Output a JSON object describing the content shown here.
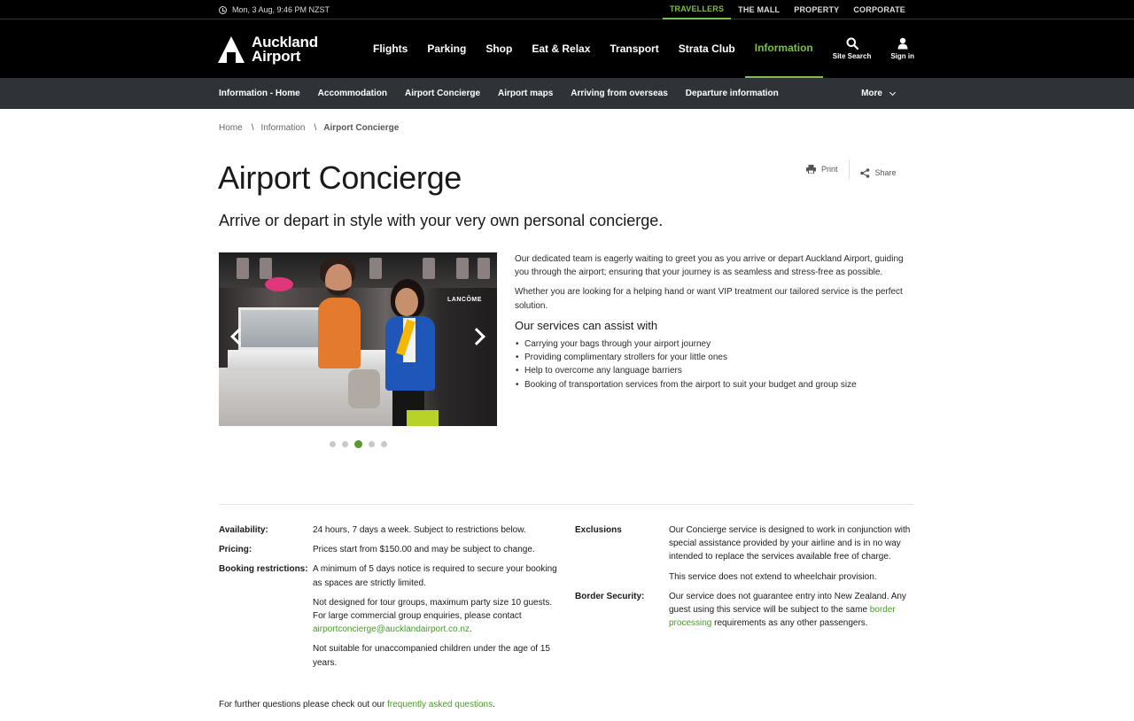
{
  "topbar": {
    "datetime": "Mon, 3 Aug, 9:46 PM NZST",
    "links": [
      "TRAVELLERS",
      "THE MALL",
      "PROPERTY",
      "CORPORATE"
    ]
  },
  "logo": {
    "line1": "Auckland",
    "line2": "Airport"
  },
  "mainnav": [
    "Flights",
    "Parking",
    "Shop",
    "Eat & Relax",
    "Transport",
    "Strata Club",
    "Information"
  ],
  "header_icons": {
    "search": "Site Search",
    "signin": "Sign in"
  },
  "subnav": {
    "items": [
      "Information - Home",
      "Accommodation",
      "Airport Concierge",
      "Airport maps",
      "Arriving from overseas",
      "Departure information"
    ],
    "more": "More"
  },
  "breadcrumb": {
    "home": "Home",
    "section": "Information",
    "current": "Airport Concierge",
    "sep": "\\"
  },
  "page": {
    "title": "Airport Concierge",
    "subtitle": "Arrive or depart in style with your very own personal concierge.",
    "print": "Print",
    "share": "Share"
  },
  "carousel": {
    "sign_text": "LANCÔME",
    "active_slide": 3,
    "slide_count": 5
  },
  "content": {
    "p1": "Our dedicated team is eagerly waiting to greet you as you arrive or depart Auckland Airport, guiding you through the airport; ensuring that your journey is as seamless and stress-free as possible.",
    "p2": "Whether you are looking for a helping hand or want VIP treatment our tailored service is the perfect solution.",
    "services_heading": "Our services can assist with",
    "services": [
      "Carrying your bags through your airport journey",
      "Providing complimentary strollers for your little ones",
      "Help to overcome any language barriers",
      "Booking of transportation services from the airport to suit your budget and group size"
    ]
  },
  "info_left": {
    "availability_label": "Availability:",
    "availability": "24 hours, 7 days a week. Subject to restrictions below.",
    "pricing_label": "Pricing:",
    "pricing": "Prices start from $150.00 and may be subject to change.",
    "booking_label": "Booking restrictions:",
    "booking_1": "A minimum of 5 days notice is required to secure your booking as spaces are strictly limited.",
    "booking_2_pre": "Not designed for tour groups, maximum party size 10 guests. For large commercial group enquiries, please contact ",
    "booking_2_link": "airportconcierge@aucklandairport.co.nz",
    "booking_2_post": ".",
    "booking_3": "Not suitable for unaccompanied children under the age of 15 years."
  },
  "info_right": {
    "exclusions_label": "Exclusions",
    "exclusions_1": "Our Concierge service is designed to work in conjunction with special assistance provided by your airline and is in no way intended to replace the services available free of charge.",
    "exclusions_2": "This service does not extend to wheelchair provision.",
    "border_label": "Border Security:",
    "border_pre": "Our service does not guarantee entry into New Zealand. Any guest using this service will be subject to the same ",
    "border_link": "border processing",
    "border_post": " requirements as any other passengers."
  },
  "footer": {
    "pre": "For further questions please check out our ",
    "link": "frequently asked questions",
    "post": "."
  },
  "colors": {
    "accent": "#7cbf4a",
    "link": "#4a9a2a",
    "header_bg": "#000000",
    "subnav_bg": "#2f3338"
  }
}
